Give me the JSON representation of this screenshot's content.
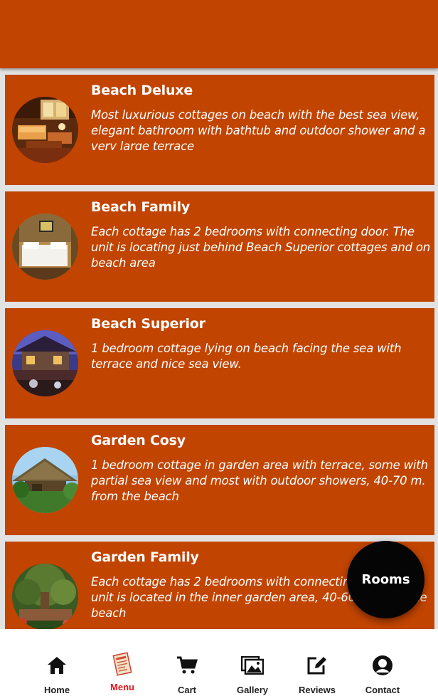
{
  "colors": {
    "primary": "#c14400",
    "list_background": "#e2e2e2",
    "fab_background": "#050505",
    "nav_active": "#e8161c",
    "nav_inactive": "#222222"
  },
  "rooms": [
    {
      "title": "Beach Deluxe",
      "description": "Most luxurious cottages on beach with the best sea view, elegant bathroom with bathtub and outdoor shower and a very large terrace",
      "image": "beach-deluxe-room-photo"
    },
    {
      "title": "Beach Family",
      "description": "Each cottage has 2 bedrooms with connecting door. The unit is locating just behind Beach Superior cottages and on beach area",
      "image": "beach-family-room-photo"
    },
    {
      "title": "Beach Superior",
      "description": "1 bedroom cottage lying on beach facing the sea with terrace and nice sea view.",
      "image": "beach-superior-room-photo"
    },
    {
      "title": "Garden Cosy",
      "description": "1 bedroom cottage in garden area with terrace, some with partial sea view and most with outdoor showers, 40-70 m. from the beach",
      "image": "garden-cosy-room-photo"
    },
    {
      "title": "Garden Family",
      "description": "Each cottage has 2 bedrooms with connecting door. The unit is located in the inner garden area, 40-60 m. from the beach",
      "image": "garden-family-room-photo"
    }
  ],
  "fab": {
    "label": "Rooms"
  },
  "bottom_nav": {
    "active": "Menu",
    "items": [
      {
        "label": "Home",
        "icon": "home-icon"
      },
      {
        "label": "Menu",
        "icon": "menu-book-icon"
      },
      {
        "label": "Cart",
        "icon": "cart-icon"
      },
      {
        "label": "Gallery",
        "icon": "gallery-icon"
      },
      {
        "label": "Reviews",
        "icon": "edit-review-icon"
      },
      {
        "label": "Contact",
        "icon": "contact-person-icon"
      }
    ]
  }
}
